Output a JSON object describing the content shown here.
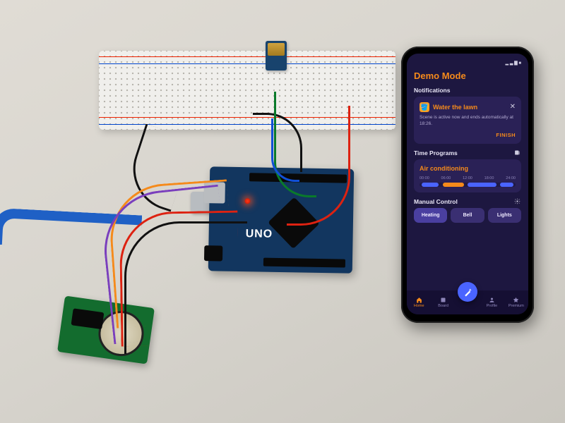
{
  "hardware": {
    "breadboard": "Solderless breadboard",
    "bluetooth_module": "Bluetooth serial module",
    "microcontroller": {
      "board": "Arduino UNO",
      "label": "UNO"
    },
    "rtc_module": "DS1302 RTC with coin cell",
    "usb_cable": "USB-B cable (blue)",
    "wires": [
      "black",
      "black",
      "red",
      "green",
      "blue",
      "orange",
      "purple",
      "red",
      "black"
    ]
  },
  "phone_app": {
    "title": "Demo Mode",
    "sections": {
      "notifications": {
        "header": "Notifications",
        "card": {
          "title": "Water the lawn",
          "description": "Scene is active now and ends automatically at 18:26.",
          "action": "FINISH"
        }
      },
      "time_programs": {
        "header": "Time Programs",
        "card": {
          "title": "Air conditioning",
          "ticks": [
            "00:00",
            "06:00",
            "12:00",
            "18:00",
            "24:00"
          ]
        }
      },
      "manual_control": {
        "header": "Manual Control",
        "tabs": [
          "Heating",
          "Bell",
          "Lights"
        ],
        "active_tab_index": 0
      }
    },
    "bottom_nav": {
      "items": [
        "Home",
        "Board",
        "",
        "Profile",
        "Premium"
      ],
      "active_index": 0
    }
  }
}
